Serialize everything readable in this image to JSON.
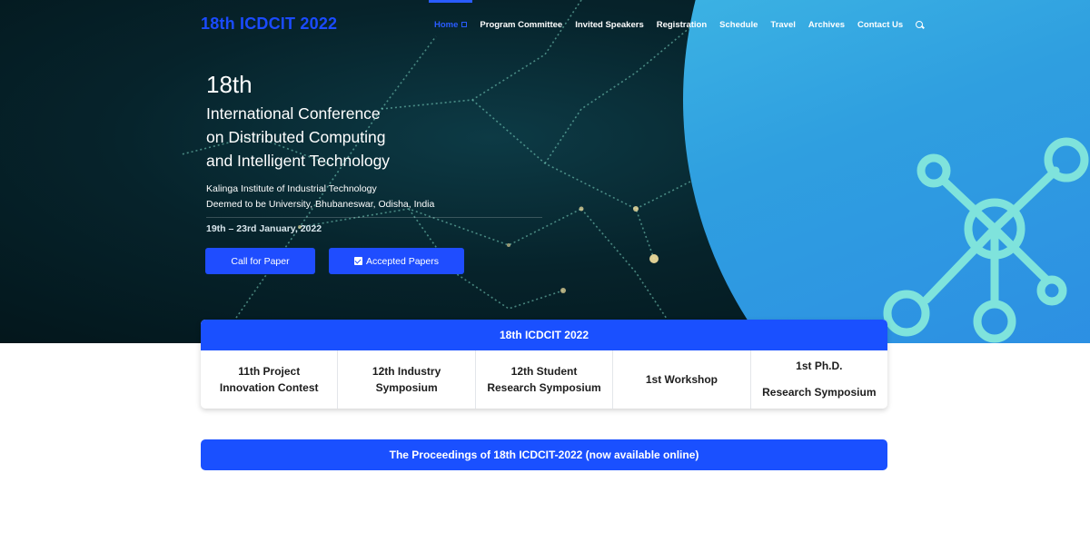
{
  "header": {
    "logo": "18th ICDCIT 2022",
    "nav": [
      {
        "label": "Home",
        "active": true
      },
      {
        "label": "Program Committee"
      },
      {
        "label": "Invited Speakers"
      },
      {
        "label": "Registration"
      },
      {
        "label": "Schedule"
      },
      {
        "label": "Travel"
      },
      {
        "label": "Archives"
      },
      {
        "label": "Contact Us"
      }
    ],
    "search_icon": "search-icon"
  },
  "hero": {
    "edition": "18th",
    "name_lines": [
      "International Conference",
      "on Distributed Computing",
      "and Intelligent Technology"
    ],
    "institute_lines": [
      "Kalinga Institute of Industrial Technology",
      "Deemed to be University, Bhubaneswar, Odisha, India"
    ],
    "dates": "19th – 23rd January, 2022",
    "buttons": {
      "call_for_paper": "Call for Paper",
      "accepted_papers": "Accepted Papers"
    }
  },
  "events_card": {
    "title": "18th ICDCIT 2022",
    "items": [
      {
        "line1": "11th Project",
        "line2": "Innovation Contest"
      },
      {
        "line1": "12th Industry",
        "line2": "Symposium"
      },
      {
        "line1": "12th Student",
        "line2": "Research Symposium"
      },
      {
        "line1": "1st Workshop",
        "line2": ""
      },
      {
        "line1": "1st Ph.D.",
        "line2": "Research Symposium"
      }
    ]
  },
  "proceedings": {
    "label": "The Proceedings of 18th ICDCIT-2022 (now available online)"
  },
  "colors": {
    "accent": "#1a50ff",
    "hero_dark": "#06232b",
    "arc_light": "#4fd0e8",
    "arc_dark": "#2a7fe6",
    "network_icon": "#7fe3dc"
  }
}
